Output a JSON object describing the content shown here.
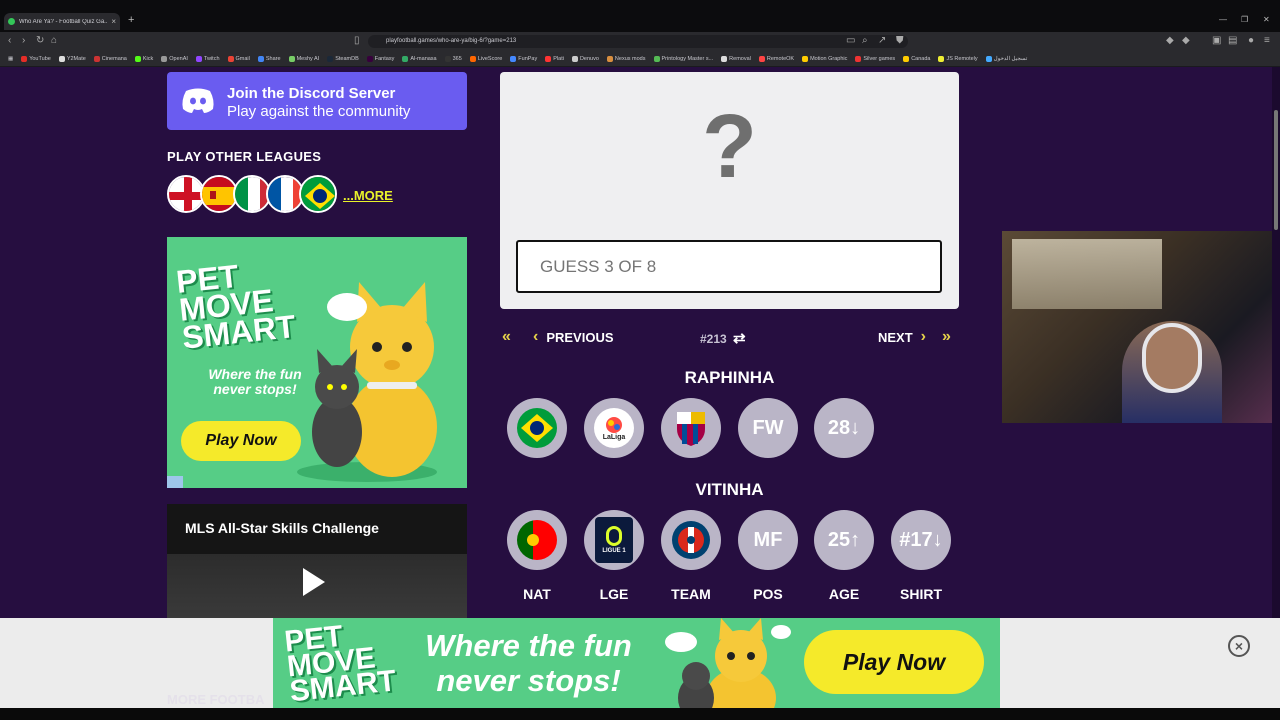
{
  "browser": {
    "tab_title": "Who Are Ya? - Football Quiz Ga...",
    "url": "playfootball.games/who-are-ya/big-6/?game=213",
    "bookmarks": [
      "YouTube",
      "Y2Mate",
      "Cinemana",
      "Kick",
      "OpenAI",
      "Twitch",
      "Gmail",
      "Share",
      "Meshy AI",
      "SteamDB",
      "Fantasy",
      "Al-manasa",
      "365",
      "LiveScore",
      "FunPay",
      "Plati",
      "Denuvo",
      "Nexus mods",
      "Printology Master s...",
      "Removal",
      "RemoteOK",
      "Motion Graphic",
      "Silver games",
      "Canada",
      "JS Remotely",
      "تسجيل الدخول"
    ]
  },
  "discord": {
    "title": "Join the Discord Server",
    "subtitle": "Play against the community"
  },
  "leagues": {
    "heading": "PLAY OTHER LEAGUES",
    "more_label": "...MORE",
    "flags": [
      "england-flag",
      "spain-flag",
      "italy-flag",
      "france-flag",
      "brazil-flag"
    ]
  },
  "side_ad": {
    "title_line1": "PET",
    "title_line2": "MOVE",
    "title_line3": "SMART",
    "subtitle": "Where the fun never stops!",
    "button": "Play Now"
  },
  "video": {
    "title": "MLS All-Star Skills Challenge"
  },
  "quiz": {
    "mystery": "?",
    "guess_placeholder": "GUESS 3 OF 8",
    "previous_label": "PREVIOUS",
    "next_label": "NEXT",
    "game_number": "#213"
  },
  "guesses": [
    {
      "name": "RAPHINHA",
      "nat": "brazil",
      "league": "LaLiga",
      "team": "barcelona",
      "pos": "FW",
      "age": "28↓"
    },
    {
      "name": "VITINHA",
      "nat": "portugal",
      "league": "LIGUE 1",
      "team": "psg",
      "pos": "MF",
      "age": "25↑",
      "shirt": "#17↓"
    }
  ],
  "columns": [
    "NAT",
    "LGE",
    "TEAM",
    "POS",
    "AGE",
    "SHIRT"
  ],
  "bottom_ad": {
    "title_line1": "PET",
    "title_line2": "MOVE",
    "title_line3": "SMART",
    "subtitle": "Where the fun never stops!",
    "button": "Play Now"
  },
  "more_football": "MORE FOOTBA",
  "colors": {
    "page_bg": "#260e40",
    "discord": "#6a5cf0",
    "accent_yellow": "#e9f22a",
    "circle": "#bab5c7",
    "ad_green": "#56cd86"
  }
}
